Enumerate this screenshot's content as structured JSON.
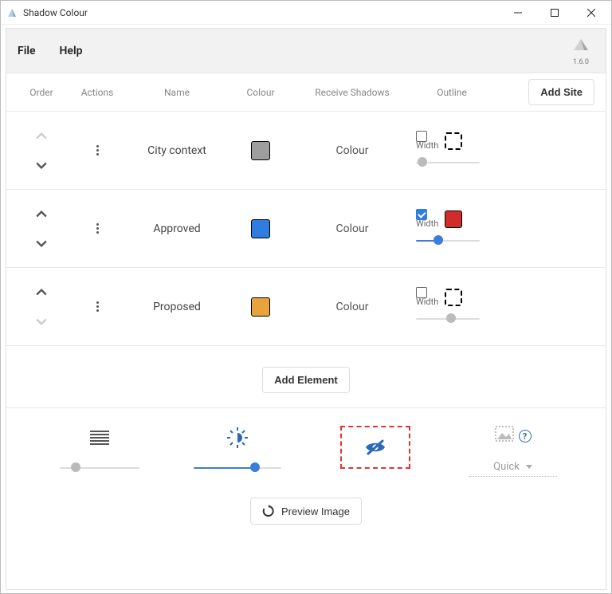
{
  "window": {
    "title": "Shadow Colour",
    "version": "1.6.0"
  },
  "menu": {
    "file": "File",
    "help": "Help"
  },
  "table": {
    "headers": {
      "order": "Order",
      "actions": "Actions",
      "name": "Name",
      "colour": "Colour",
      "receive": "Receive Shadows",
      "outline": "Outline"
    },
    "add_site_label": "Add Site",
    "width_label": "Width"
  },
  "rows": [
    {
      "name": "City context",
      "colour": "#9e9e9e",
      "receive_mode": "Colour",
      "up_enabled": false,
      "down_enabled": true,
      "outline_enabled": false,
      "outline_colour": "#ffffff",
      "outline_dashed": true,
      "width_value": 10
    },
    {
      "name": "Approved",
      "colour": "#2f7de1",
      "receive_mode": "Colour",
      "up_enabled": true,
      "down_enabled": true,
      "outline_enabled": true,
      "outline_colour": "#d22b2b",
      "outline_dashed": false,
      "width_value": 35
    },
    {
      "name": "Proposed",
      "colour": "#e8a33d",
      "receive_mode": "Colour",
      "up_enabled": true,
      "down_enabled": false,
      "outline_enabled": false,
      "outline_colour": "#ffffff",
      "outline_dashed": true,
      "width_value": 55
    }
  ],
  "add_element_label": "Add Element",
  "bottom": {
    "line_density_value": 20,
    "brightness_value": 70,
    "quality_label": "Quick",
    "preview_label": "Preview Image"
  }
}
